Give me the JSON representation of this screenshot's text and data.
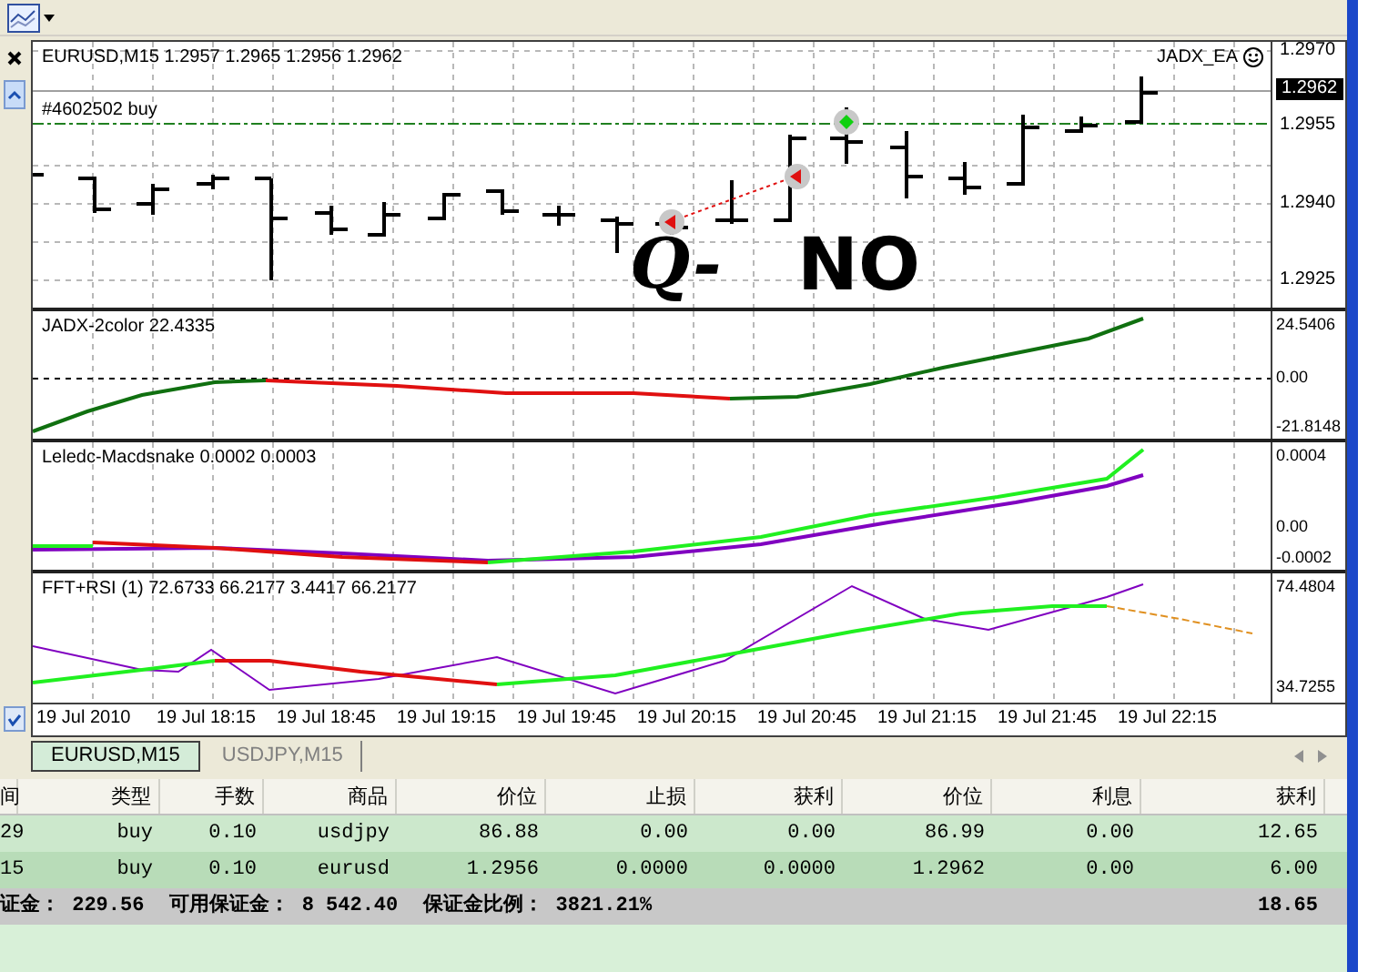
{
  "chart": {
    "symbol_info": "EURUSD,M15  1.2957 1.2965 1.2956 1.2962",
    "ea_name": "JADX_EA",
    "order_label": "#4602502 buy",
    "price_scale": [
      "1.2970",
      "1.2955",
      "1.2940",
      "1.2925"
    ],
    "current_price": "1.2962"
  },
  "handwriting": [
    "Q-",
    "NO"
  ],
  "indicators": [
    {
      "title": "JADX-2color 22.4335",
      "scale": [
        "24.5406",
        "0.00",
        "-21.8148"
      ]
    },
    {
      "title": "Leledc-Macdsnake 0.0002 0.0003",
      "scale": [
        "0.0004",
        "0.00",
        "-0.0002"
      ]
    },
    {
      "title": "FFT+RSI (1) 72.6733 66.2177 3.4417 66.2177",
      "scale": [
        "74.4804",
        "34.7255"
      ]
    }
  ],
  "time_axis": [
    "19 Jul 2010",
    "19 Jul 18:15",
    "19 Jul 18:45",
    "19 Jul 19:15",
    "19 Jul 19:45",
    "19 Jul 20:15",
    "19 Jul 20:45",
    "19 Jul 21:15",
    "19 Jul 21:45",
    "19 Jul 22:15"
  ],
  "tabs": [
    {
      "label": "EURUSD,M15",
      "selected": true
    },
    {
      "label": "USDJPY,M15",
      "selected": false
    }
  ],
  "terminal": {
    "columns": [
      "间",
      "类型",
      "手数",
      "商品",
      "价位",
      "止损",
      "获利",
      "价位",
      "利息",
      "获利"
    ],
    "rows": [
      {
        "cells": [
          "29",
          "buy",
          "0.10",
          "usdjpy",
          "86.88",
          "0.00",
          "0.00",
          "86.99",
          "0.00",
          "12.65"
        ],
        "selected": false
      },
      {
        "cells": [
          "15",
          "buy",
          "0.10",
          "eurusd",
          "1.2956",
          "0.0000",
          "0.0000",
          "1.2962",
          "0.00",
          "6.00"
        ],
        "selected": true
      }
    ],
    "summary": [
      "证金： 229.56",
      "可用保证金： 8 542.40",
      "保证金比例： 3821.21%"
    ],
    "total": "18.65"
  }
}
